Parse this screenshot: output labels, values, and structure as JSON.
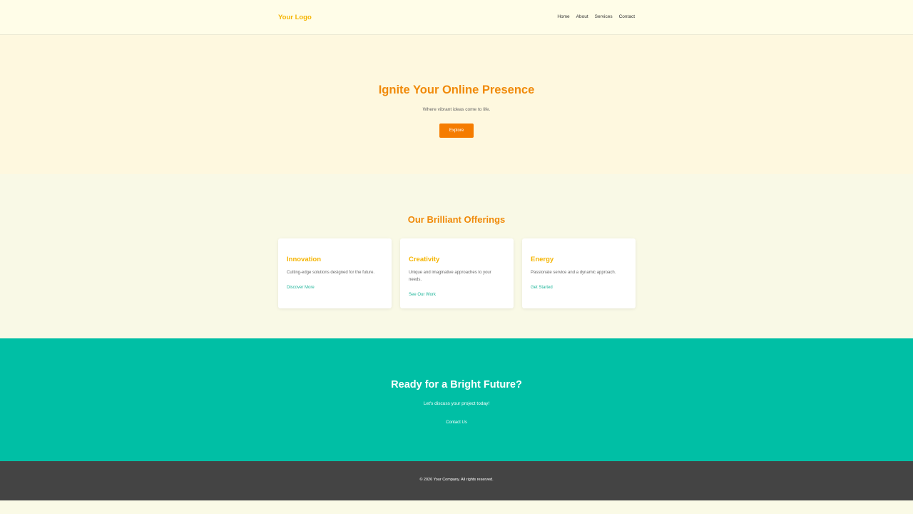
{
  "header": {
    "logo": "Your Logo",
    "nav": [
      "Home",
      "About",
      "Services",
      "Contact"
    ]
  },
  "hero": {
    "title": "Ignite Your Online Presence",
    "subtitle": "Where vibrant ideas come to life.",
    "button": "Explore"
  },
  "offerings": {
    "title": "Our Brilliant Offerings",
    "cards": [
      {
        "title": "Innovation",
        "text": "Cutting-edge solutions designed for the future.",
        "link": "Discover More"
      },
      {
        "title": "Creativity",
        "text": "Unique and imaginative approaches to your needs.",
        "link": "See Our Work"
      },
      {
        "title": "Energy",
        "text": "Passionate service and a dynamic approach.",
        "link": "Get Started"
      }
    ]
  },
  "cta": {
    "title": "Ready for a Bright Future?",
    "text": "Let's discuss your project today!",
    "button": "Contact Us"
  },
  "footer": {
    "copyright": "© 2026 Your Company. All rights reserved."
  },
  "colors": {
    "accent_orange": "#f08a0a",
    "accent_yellow": "#f5b400",
    "button_orange": "#f57c00",
    "teal": "#00bfa5",
    "footer_bg": "#444444"
  }
}
